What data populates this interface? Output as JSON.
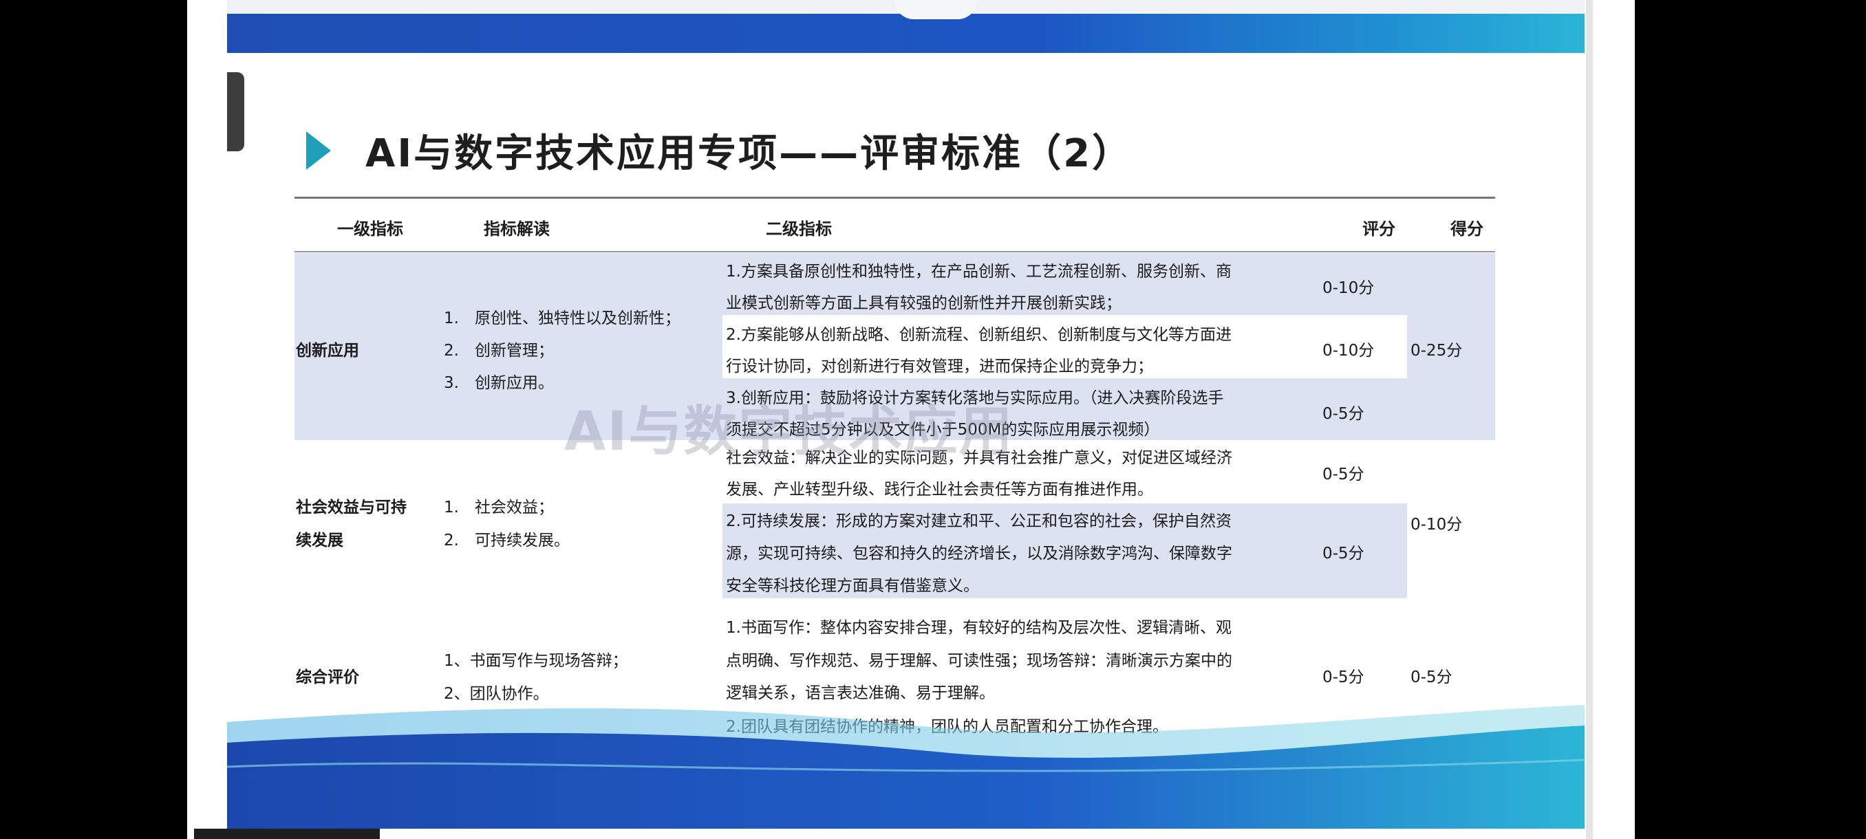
{
  "slide": {
    "title": "AI与数字技术应用专项——评审标准（2）",
    "watermark": "AI与数字技术应用"
  },
  "table": {
    "headers": {
      "level1": "一级指标",
      "interpretation": "指标解读",
      "level2": "二级指标",
      "score_range": "评分",
      "score": "得分"
    },
    "rows": {
      "innovation": {
        "level1": "创新应用",
        "interp": [
          "1.　原创性、独特性以及创新性；",
          "2.　创新管理；",
          "3.　创新应用。"
        ],
        "sub1_lines": [
          "1.方案具备原创性和独特性，在产品创新、工艺流程创新、服务创新、商",
          "业模式创新等方面上具有较强的创新性并开展创新实践；"
        ],
        "sub1_score": "0-10分",
        "sub2_lines": [
          "2.方案能够从创新战略、创新流程、创新组织、创新制度与文化等方面进",
          "行设计协同，对创新进行有效管理，进而保持企业的竞争力；"
        ],
        "sub2_score": "0-10分",
        "sub3_lines": [
          "3.创新应用：鼓励将设计方案转化落地与实际应用。（进入决赛阶段选手",
          "须提交不超过5分钟以及文件小于500M的实际应用展示视频）"
        ],
        "sub3_score": "0-5分",
        "total": "0-25分"
      },
      "social": {
        "level1_lines": [
          "社会效益与可持",
          "续发展"
        ],
        "interp": [
          "1.　社会效益；",
          "2.　可持续发展。"
        ],
        "sub1_lines": [
          "社会效益：解决企业的实际问题，并具有社会推广意义，对促进区域经济",
          "发展、产业转型升级、践行企业社会责任等方面有推进作用。"
        ],
        "sub1_score": "0-5分",
        "sub2_lines": [
          "2.可持续发展：形成的方案对建立和平、公正和包容的社会，保护自然资",
          "源，实现可持续、包容和持久的经济增长，以及消除数字鸿沟、保障数字",
          "安全等科技伦理方面具有借鉴意义。"
        ],
        "sub2_score": "0-5分",
        "total": "0-10分"
      },
      "overall": {
        "level1": "综合评价",
        "interp": [
          "1、书面写作与现场答辩；",
          "2、团队协作。"
        ],
        "sub_lines": [
          "1.书面写作：整体内容安排合理，有较好的结构及层次性、逻辑清晰、观",
          "点明确、写作规范、易于理解、可读性强；现场答辩：清晰演示方案中的",
          "逻辑关系，语言表达准确、易于理解。",
          "2.团队具有团结协作的精神，团队的人员配置和分工协作合理。"
        ],
        "sub_score": "0-5分",
        "total": "0-5分"
      }
    }
  },
  "colors": {
    "band": "#dde2f3",
    "accent_triangle": "#20a0b8",
    "top_bar": "#1f4fb4"
  }
}
